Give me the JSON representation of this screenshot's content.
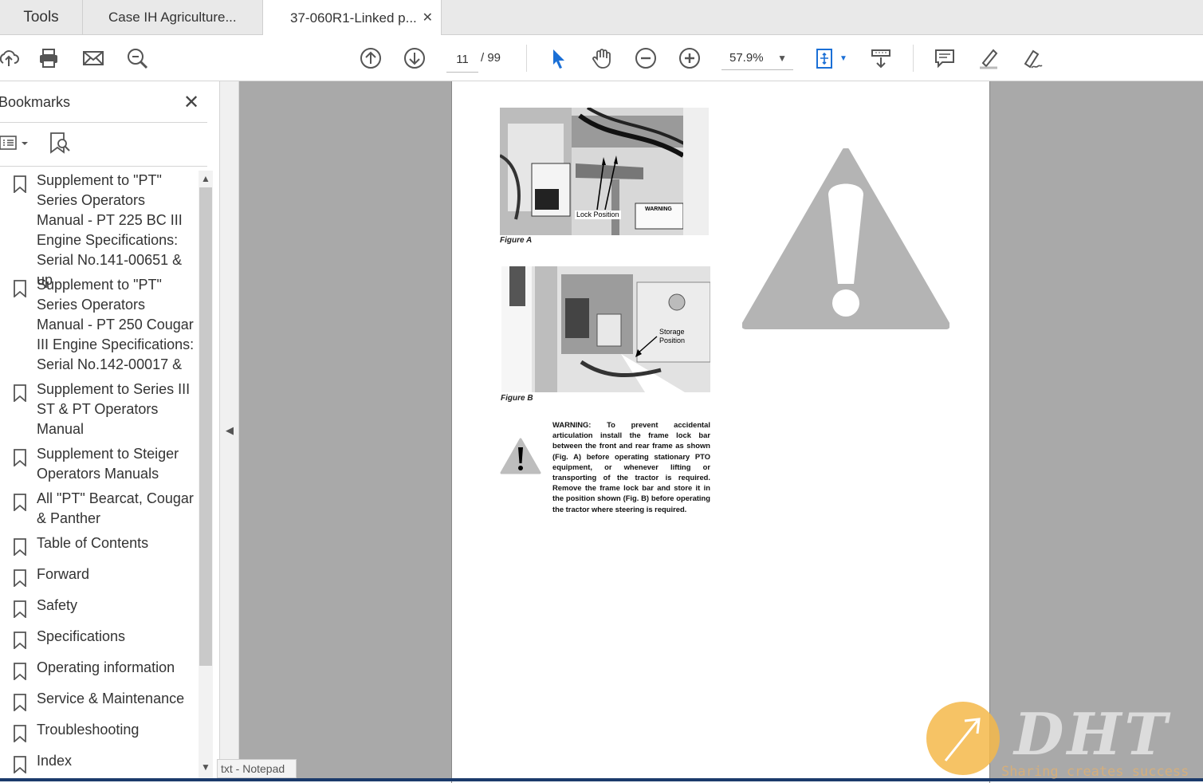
{
  "tabs": {
    "tools": "Tools",
    "doc1": "Case IH Agriculture...",
    "doc2": "37-060R1-Linked p...",
    "close_glyph": "✕"
  },
  "toolbar": {
    "icons": [
      "upload-icon",
      "print-icon",
      "mail-icon",
      "zoom-search-icon",
      "page-up-icon",
      "page-down-icon",
      "select-arrow-icon",
      "hand-icon",
      "zoom-out-icon",
      "zoom-in-icon",
      "fit-page-icon",
      "scroll-mode-icon",
      "comment-icon",
      "highlight-icon",
      "sign-icon"
    ],
    "page_current": "11",
    "page_total": "/ 99",
    "zoom": "57.9%"
  },
  "sidebar": {
    "title": "Bookmarks",
    "close_glyph": "✕",
    "bookmarks": [
      "Supplement to \"PT\" Series Operators Manual - PT 225 BC III Engine Specifications: Serial No.141-00651 & up",
      "Supplement to \"PT\" Series Operators Manual - PT 250 Cougar III Engine Specifications: Serial No.142-00017 &",
      "Supplement to Series III ST & PT Operators Manual",
      "Supplement to Steiger Operators Manuals",
      "All \"PT\" Bearcat, Cougar & Panther",
      "Table of Contents",
      "Forward",
      "Safety",
      "Specifications",
      "Operating information",
      "Service & Maintenance",
      "Troubleshooting",
      "Index"
    ]
  },
  "document": {
    "figure_a_caption": "Figure A",
    "figure_a_callout": "Lock Position",
    "figure_a_sign": "WARNING",
    "figure_b_caption": "Figure B",
    "figure_b_callout_1": "Storage",
    "figure_b_callout_2": "Position",
    "warning_text": "WARNING: To prevent accidental articulation install the frame lock bar between the front and rear frame as shown (Fig. A) before operating stationary PTO equipment, or whenever lifting or transporting of the tractor is required. Remove the frame lock bar and store it in the position shown (Fig. B) before operating the tractor where steering is required."
  },
  "taskbar": {
    "notepad": "txt - Notepad"
  },
  "watermark": {
    "brand": "DHT",
    "slogan": "Sharing creates success"
  }
}
